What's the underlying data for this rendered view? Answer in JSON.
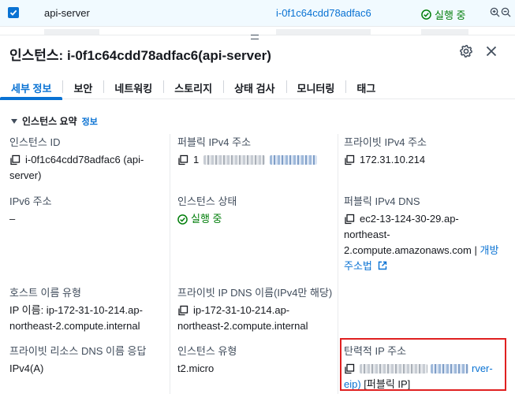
{
  "top_row": {
    "name": "api-server",
    "instance_id": "i-0f1c64cdd78adfac6",
    "status": "실행 중"
  },
  "panel": {
    "title": "인스턴스: i-0f1c64cdd78adfac6(api-server)"
  },
  "tabs": [
    {
      "label": "세부 정보",
      "active": true
    },
    {
      "label": "보안"
    },
    {
      "label": "네트워킹"
    },
    {
      "label": "스토리지"
    },
    {
      "label": "상태 검사"
    },
    {
      "label": "모니터링"
    },
    {
      "label": "태그"
    }
  ],
  "section": {
    "title": "인스턴스 요약",
    "info_link": "정보"
  },
  "fields": {
    "instance_id": {
      "label": "인스턴스 ID",
      "value_line1": "i-0f1c64cdd78adfac6 (api-",
      "value_line2": "server)"
    },
    "public_ipv4": {
      "label": "퍼블릭 IPv4 주소",
      "value_prefix": "1"
    },
    "private_ipv4": {
      "label": "프라이빗 IPv4 주소",
      "value": "172.31.10.214"
    },
    "ipv6": {
      "label": "IPv6 주소",
      "value": "–"
    },
    "instance_state": {
      "label": "인스턴스 상태",
      "value": "실행 중"
    },
    "public_dns": {
      "label": "퍼블릭 IPv4 DNS",
      "value_line1": "ec2-13-124-30-29.ap-",
      "value_line2": "northeast-",
      "value_line3": "2.compute.amazonaws.com",
      "sep": "|",
      "open_link_a": "개방",
      "open_link_b": "주소법"
    },
    "hostname_type": {
      "label": "호스트 이름 유형",
      "value_line1": "IP 이름: ip-172-31-10-214.ap-",
      "value_line2": "northeast-2.compute.internal"
    },
    "private_dns": {
      "label": "프라이빗 IP DNS 이름(IPv4만 해당)",
      "value_line1": "ip-172-31-10-214.ap-",
      "value_line2": "northeast-2.compute.internal"
    },
    "resource_dns": {
      "label": "프라이빗 리소스 DNS 이름 응답",
      "value": "IPv4(A)"
    },
    "instance_type": {
      "label": "인스턴스 유형",
      "value": "t2.micro"
    },
    "elastic_ip": {
      "label": "탄력적 IP 주소",
      "value_tail": "rver-",
      "value_line2_link": "eip)",
      "value_line2_rest": " [퍼블릭 IP]"
    }
  },
  "colors": {
    "link": "#0972d3",
    "success": "#037f0c",
    "highlight": "#e02020"
  },
  "icons": [
    "check-icon",
    "zoom-in-icon",
    "zoom-out-icon",
    "gear-icon",
    "close-icon",
    "copy-icon",
    "status-check-icon",
    "external-link-icon",
    "caret-down-icon"
  ]
}
